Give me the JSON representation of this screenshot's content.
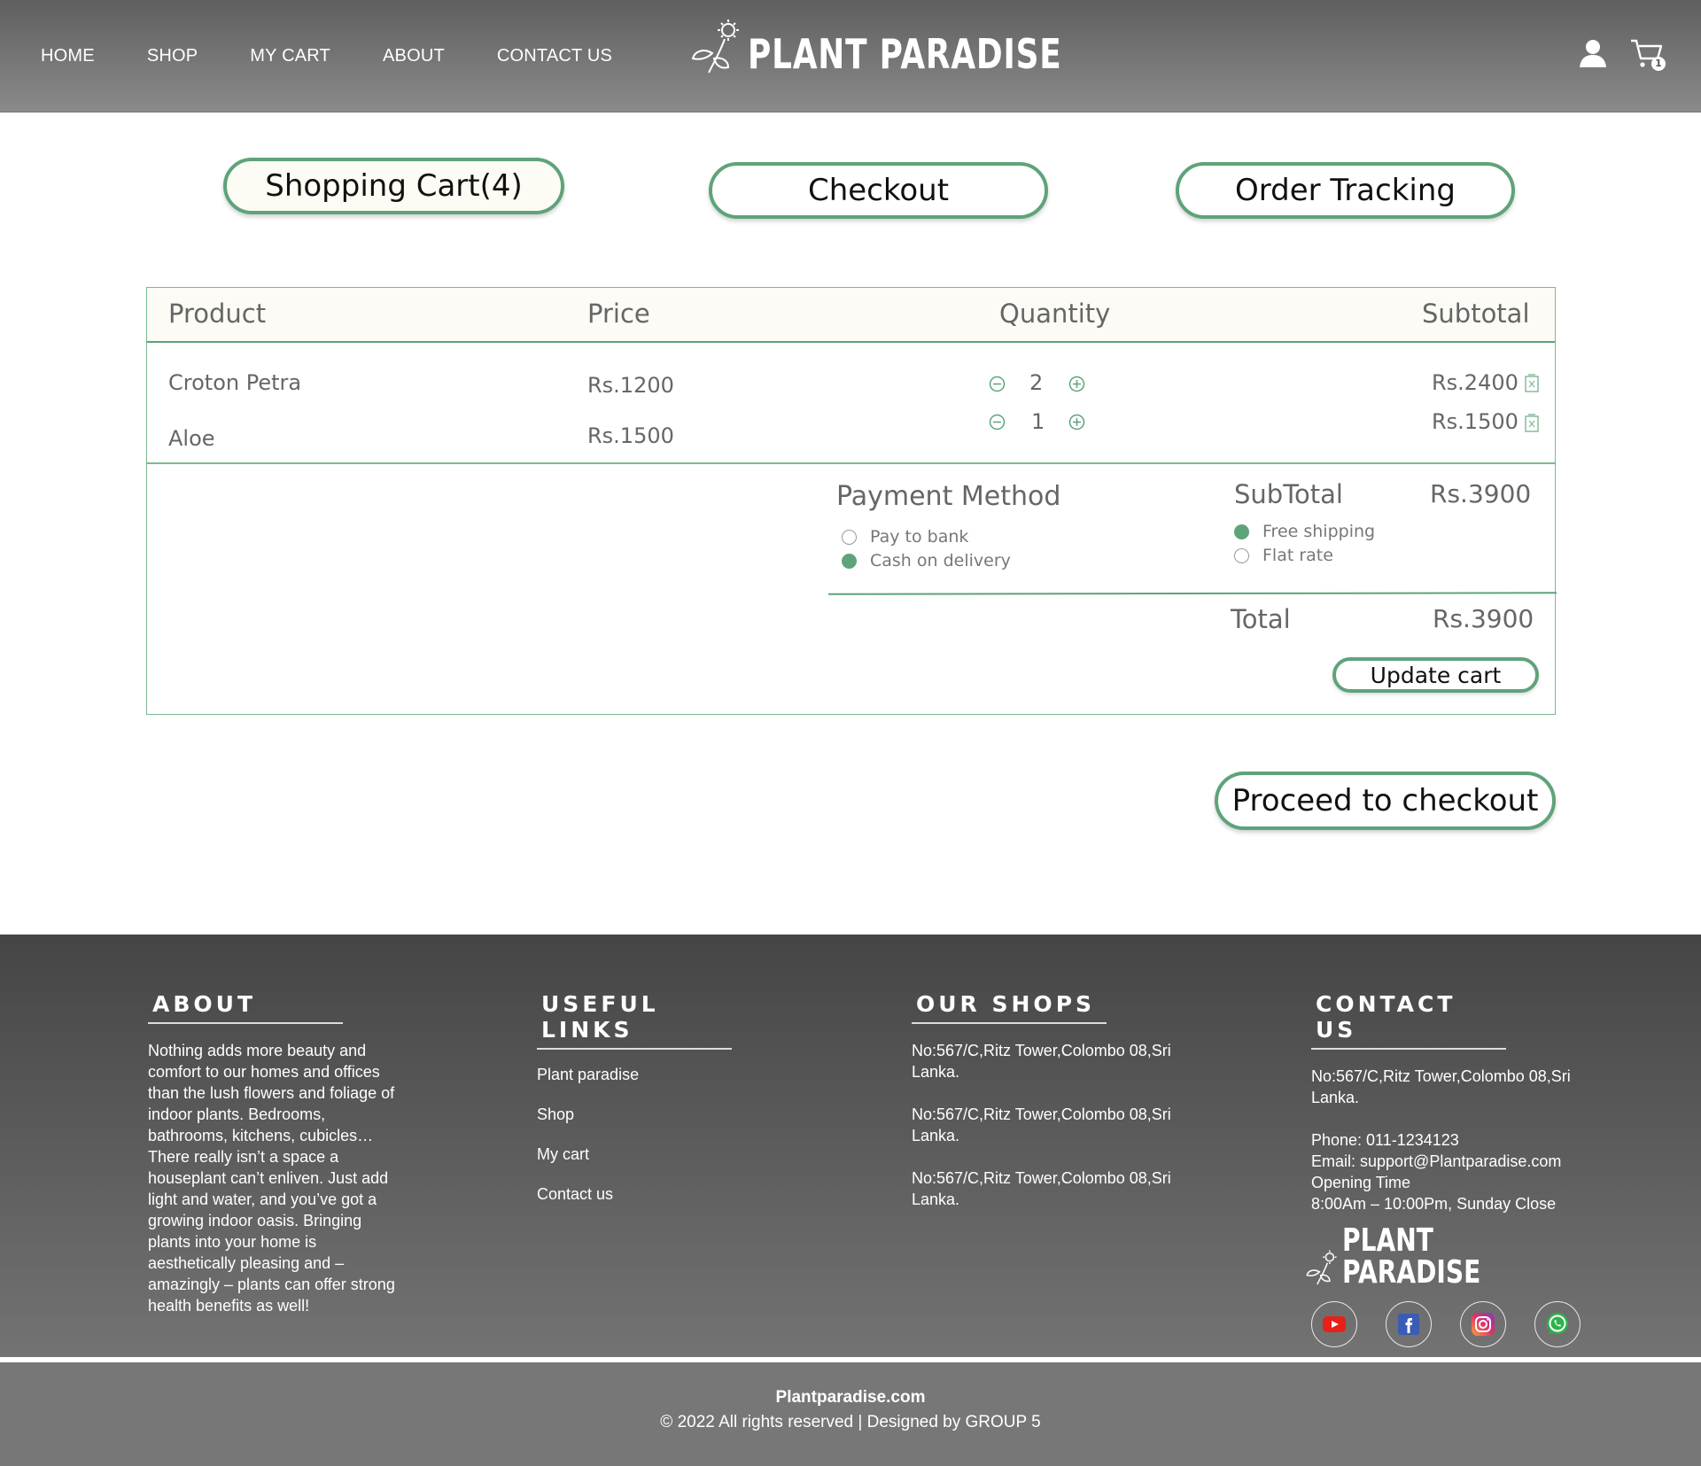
{
  "header": {
    "nav": [
      "HOME",
      "SHOP",
      "MY CART",
      "ABOUT",
      "CONTACT US"
    ],
    "brand": "PLANT  PARADISE",
    "cart_count": "1",
    "icons": [
      "user-icon",
      "cart-icon"
    ]
  },
  "tabs": {
    "cart": "Shopping Cart(4)",
    "checkout": "Checkout",
    "tracking": "Order Tracking"
  },
  "cart": {
    "columns": {
      "product": "Product",
      "price": "Price",
      "quantity": "Quantity",
      "subtotal": "Subtotal"
    },
    "items": [
      {
        "product": "Croton Petra",
        "price": "Rs.1200",
        "qty": "2",
        "subtotal": "Rs.2400"
      },
      {
        "product": "Aloe",
        "price": "Rs.1500",
        "qty": "1",
        "subtotal": "Rs.1500"
      }
    ],
    "payment": {
      "title": "Payment Method",
      "options": [
        "Pay to bank",
        "Cash on delivery"
      ],
      "selected": "Cash on delivery"
    },
    "summary": {
      "subtotal_label": "SubTotal",
      "subtotal_value": "Rs.3900",
      "shipping_options": [
        "Free shipping",
        "Flat rate"
      ],
      "shipping_selected": "Free shipping",
      "total_label": "Total",
      "total_value": "Rs.3900"
    },
    "update_label": "Update cart"
  },
  "proceed_label": "Proceed to checkout",
  "footer": {
    "about": {
      "title": "ABOUT",
      "text": "Nothing adds more beauty and comfort to our homes and offices than the lush flowers and foliage of indoor plants. Bedrooms, bathrooms, kitchens, cubicles… There really isn’t a space a houseplant can’t enliven. Just add light and water, and you’ve got a growing indoor oasis. Bringing plants into your home is aesthetically pleasing and – amazingly – plants can offer strong health benefits as well!"
    },
    "links": {
      "title": "USEFUL LINKS",
      "items": [
        "Plant paradise",
        "Shop",
        "My cart",
        "Contact us"
      ]
    },
    "shops": {
      "title": "OUR SHOPS",
      "items": [
        "No:567/C,Ritz Tower,Colombo 08,Sri Lanka.",
        "No:567/C,Ritz Tower,Colombo 08,Sri Lanka.",
        "No:567/C,Ritz Tower,Colombo 08,Sri Lanka."
      ]
    },
    "contact": {
      "title": "CONTACT US",
      "address": "No:567/C,Ritz Tower,Colombo 08,Sri Lanka.",
      "phone": "Phone: 011-1234123",
      "email": "Email: support@Plantparadise.com",
      "opening_label": "Opening Time",
      "hours": "8:00Am – 10:00Pm, Sunday Close",
      "brand": "PLANT  PARADISE",
      "socials": [
        "youtube-icon",
        "facebook-icon",
        "instagram-icon",
        "whatsapp-icon"
      ]
    },
    "site": "Plantparadise.com",
    "copyright": "© 2022 All rights reserved | Designed by GROUP 5"
  },
  "colors": {
    "accent": "#5ea37a",
    "header_top": "#5f5f5f",
    "footer_bottom": "#777777"
  }
}
